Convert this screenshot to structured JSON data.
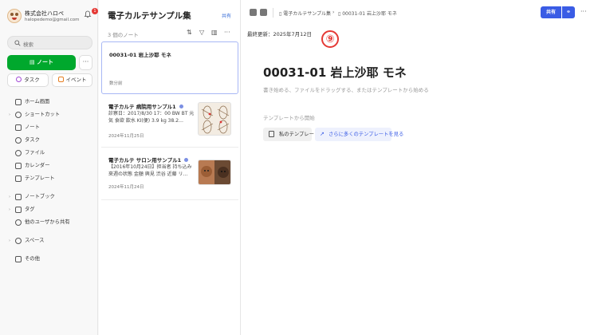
{
  "sidebar": {
    "account_name": "株式会社ハロペ",
    "account_email": "halopedemo@gmail.com",
    "notification_count": "1",
    "search_placeholder": "検索",
    "new_note_label": "ノート",
    "more_label": "···",
    "task_label": "タスク",
    "event_label": "イベント",
    "nav": [
      {
        "label": "ホーム画面",
        "icon": "home-icon"
      },
      {
        "label": "ショートカット",
        "icon": "star-icon"
      },
      {
        "label": "ノート",
        "icon": "note-icon"
      },
      {
        "label": "タスク",
        "icon": "task-icon"
      },
      {
        "label": "ファイル",
        "icon": "attachment-icon"
      },
      {
        "label": "カレンダー",
        "icon": "calendar-icon"
      },
      {
        "label": "テンプレート",
        "icon": "template-icon"
      },
      {
        "label": "ノートブック",
        "icon": "notebook-icon"
      },
      {
        "label": "タグ",
        "icon": "tag-icon"
      },
      {
        "label": "他のユーザから共有",
        "icon": "shared-users-icon"
      },
      {
        "label": "スペース",
        "icon": "space-icon"
      },
      {
        "label": "その他",
        "icon": "grid-icon"
      }
    ]
  },
  "list": {
    "title": "電子カルテサンプル集",
    "share_label": "共有",
    "count": "3 個のノート",
    "notes": [
      {
        "title": "00031-01 岩上沙耶 モネ",
        "snippet": "",
        "date": "数分前"
      },
      {
        "title": "電子カルテ 病院用サンプル1",
        "snippet": "診察日：2017/8/30 17：00 BW BT 元気 食欲 飲水 KI(便) 3.9 kg 38.2…",
        "date": "2024年11月25日"
      },
      {
        "title": "電子カルテ サロン用サンプル1",
        "snippet": "【2016年10月24日】担当者 持ち込み 來週の状態 金額 興見 渋谷 近藤 リ…",
        "date": "2024年11月24日"
      }
    ]
  },
  "editor": {
    "breadcrumb_notebook": "電子カルテサンプル集",
    "breadcrumb_note": "00031-01 岩上沙耶 モネ",
    "share_label": "共有",
    "more_label": "···",
    "updated": "最終更新：2025年7月12日",
    "marker": "⑨",
    "title": "00031-01 岩上沙耶 モネ",
    "hint": "書き始める、ファイルをドラッグする、またはテンプレートから始める",
    "template_start": "テンプレートから開始",
    "my_templates": "私のテンプレート",
    "more_templates": "さらに多くのテンプレートを見る"
  },
  "colors": {
    "accent_green": "#00a82d",
    "accent_blue": "#3a5ce5",
    "marker_red": "#e53935"
  }
}
